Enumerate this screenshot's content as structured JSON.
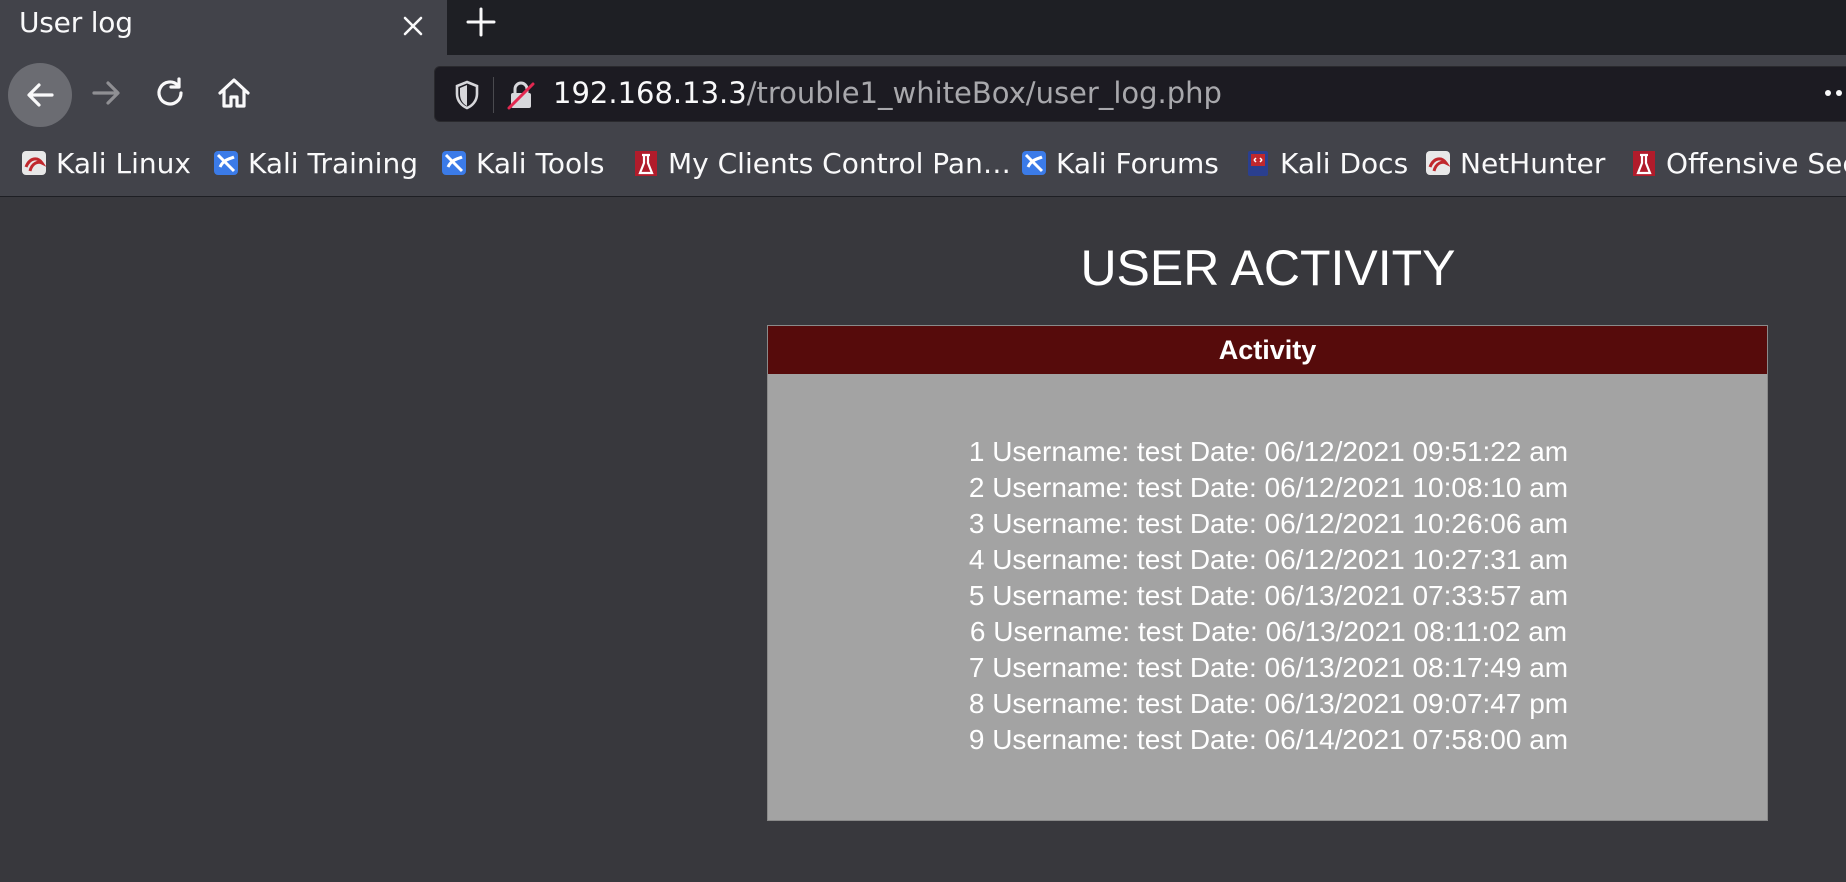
{
  "tab": {
    "title": "User log"
  },
  "url": {
    "host": "192.168.13.3",
    "path": "/trouble1_whiteBox/user_log.php"
  },
  "bookmarks": [
    {
      "label": "Kali Linux",
      "icon": "kali-dragon-icon"
    },
    {
      "label": "Kali Training",
      "icon": "kali-training-icon"
    },
    {
      "label": "Kali Tools",
      "icon": "kali-tools-icon"
    },
    {
      "label": "My Clients Control Pan…",
      "icon": "offsec-icon"
    },
    {
      "label": "Kali Forums",
      "icon": "kali-forums-icon"
    },
    {
      "label": "Kali Docs",
      "icon": "kali-docs-icon"
    },
    {
      "label": "NetHunter",
      "icon": "nethunter-icon"
    },
    {
      "label": "Offensive Sec",
      "icon": "offsec-icon"
    }
  ],
  "page": {
    "heading": "USER ACTIVITY",
    "panel_title": "Activity",
    "entries": [
      "1 Username: test Date: 06/12/2021 09:51:22 am",
      "2 Username: test Date: 06/12/2021 10:08:10 am",
      "3 Username: test Date: 06/12/2021 10:26:06 am",
      "4 Username: test Date: 06/12/2021 10:27:31 am",
      "5 Username: test Date: 06/13/2021 07:33:57 am",
      "6 Username: test Date: 06/13/2021 08:11:02 am",
      "7 Username: test Date: 06/13/2021 08:17:49 am",
      "8 Username: test Date: 06/13/2021 09:07:47 pm",
      "9 Username: test Date: 06/14/2021 07:58:00 am"
    ]
  },
  "colors": {
    "panel_header": "#560b0b",
    "panel_body": "#a3a3a3",
    "page_bg": "#38383d"
  }
}
